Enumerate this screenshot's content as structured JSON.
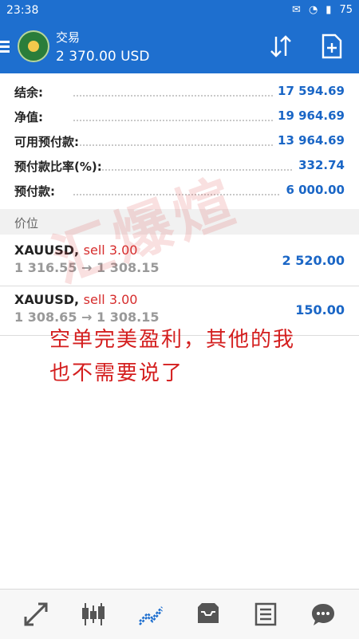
{
  "status_bar": {
    "time": "23:38",
    "battery": "75"
  },
  "app_bar": {
    "title": "交易",
    "subtitle": "2 370.00 USD",
    "icons": [
      "menu-icon",
      "app-logo",
      "sort-icon",
      "new-order-icon"
    ]
  },
  "summary": [
    {
      "label": "结余:",
      "value": "17 594.69"
    },
    {
      "label": "净值:",
      "value": "19 964.69"
    },
    {
      "label": "可用预付款:",
      "value": "13 964.69"
    },
    {
      "label": "预付款比率(%):",
      "value": "332.74"
    },
    {
      "label": "预付款:",
      "value": "6 000.00"
    }
  ],
  "positions_header": "价位",
  "positions": [
    {
      "symbol": "XAUUSD,",
      "side": "sell 3.00",
      "open": "1 316.55",
      "arrow": "→",
      "current": "1 308.15",
      "profit": "2 520.00"
    },
    {
      "symbol": "XAUUSD,",
      "side": "sell 3.00",
      "open": "1 308.65",
      "arrow": "→",
      "current": "1 308.15",
      "profit": "150.00"
    }
  ],
  "watermark": "汇爆煊",
  "annotation": {
    "line1": "空单完美盈利，其他的我",
    "line2": "也不需要说了"
  },
  "bottom_nav": [
    "quotes-icon",
    "chart-icon",
    "trade-icon",
    "history-icon",
    "news-icon",
    "chat-icon"
  ],
  "colors": {
    "primary": "#1e6fcf",
    "value_blue": "#1a66c6",
    "sell_red": "#d62c2c",
    "note_red": "#d41f1f"
  }
}
